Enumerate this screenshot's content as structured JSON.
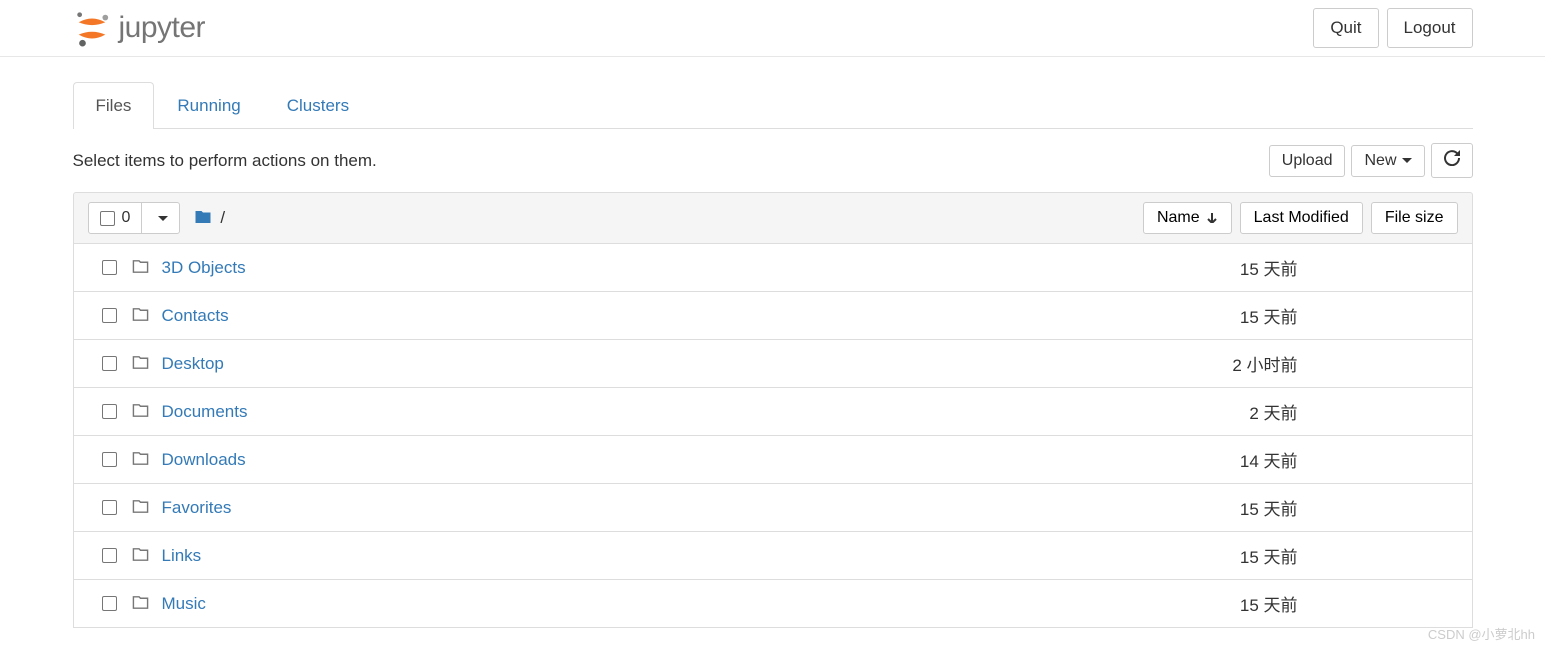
{
  "header": {
    "logo_text": "jupyter",
    "quit_label": "Quit",
    "logout_label": "Logout"
  },
  "tabs": {
    "files": "Files",
    "running": "Running",
    "clusters": "Clusters"
  },
  "toolbar": {
    "hint": "Select items to perform actions on them.",
    "upload_label": "Upload",
    "new_label": "New"
  },
  "list_header": {
    "selected_count": "0",
    "breadcrumb_sep": "/",
    "name_label": "Name",
    "modified_label": "Last Modified",
    "size_label": "File size"
  },
  "files": [
    {
      "name": "3D Objects",
      "modified": "15 天前"
    },
    {
      "name": "Contacts",
      "modified": "15 天前"
    },
    {
      "name": "Desktop",
      "modified": "2 小时前"
    },
    {
      "name": "Documents",
      "modified": "2 天前"
    },
    {
      "name": "Downloads",
      "modified": "14 天前"
    },
    {
      "name": "Favorites",
      "modified": "15 天前"
    },
    {
      "name": "Links",
      "modified": "15 天前"
    },
    {
      "name": "Music",
      "modified": "15 天前"
    }
  ],
  "watermark": "CSDN @小萝北hh"
}
